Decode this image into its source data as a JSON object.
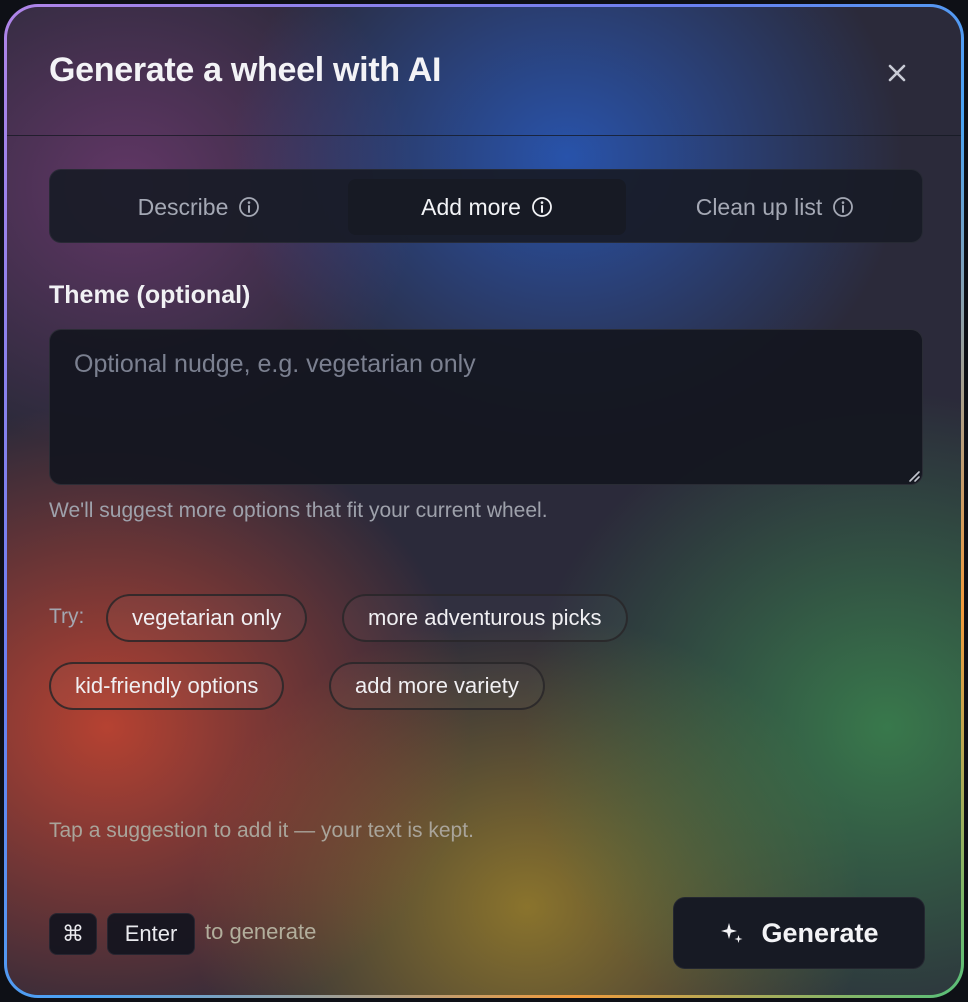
{
  "dialog": {
    "title": "Generate a wheel with AI"
  },
  "tabs": [
    {
      "label": "Describe",
      "active": false
    },
    {
      "label": "Add more",
      "active": true
    },
    {
      "label": "Clean up list",
      "active": false
    }
  ],
  "theme": {
    "label": "Theme (optional)",
    "placeholder": "Optional nudge, e.g. vegetarian only",
    "value": "",
    "helper": "We'll suggest more options that fit your current wheel."
  },
  "suggestions": {
    "try_label": "Try:",
    "chips": [
      "vegetarian only",
      "more adventurous picks",
      "kid-friendly options",
      "add more variety"
    ],
    "footnote": "Tap a suggestion to add it — your text is kept."
  },
  "footer": {
    "shortcut_key_1": "⌘",
    "shortcut_key_2": "Enter",
    "shortcut_hint": "to generate",
    "generate_label": "Generate"
  },
  "icons": {
    "close": "close-icon",
    "info": "info-icon",
    "sparkle": "sparkle-icon"
  }
}
